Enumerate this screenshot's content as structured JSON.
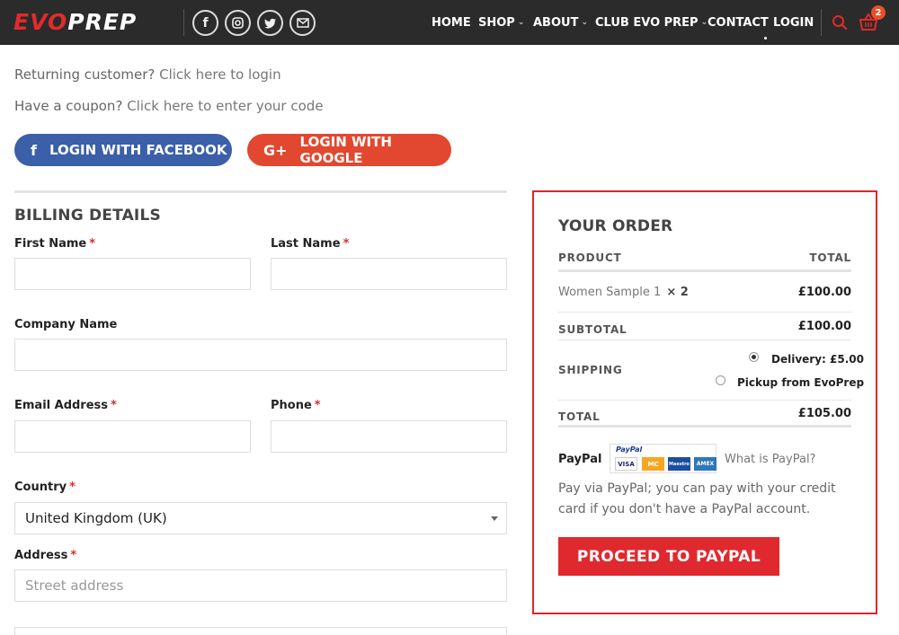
{
  "header": {
    "logo_evo": "EVO",
    "logo_prep": "PREP",
    "nav": [
      {
        "label": "HOME",
        "dropdown": false
      },
      {
        "label": "SHOP",
        "dropdown": true
      },
      {
        "label": "ABOUT",
        "dropdown": true
      },
      {
        "label": "CLUB EVO PREP",
        "dropdown": true
      },
      {
        "label": "CONTACT",
        "dropdown": false
      },
      {
        "label": "LOGIN",
        "dropdown": false
      }
    ],
    "social_icons": [
      "facebook-icon",
      "instagram-icon",
      "twitter-icon",
      "mail-icon"
    ],
    "cart_count": "2",
    "colors": {
      "bar": "#2b2b2b",
      "accent": "#e02b2b"
    }
  },
  "notices": {
    "returning_prefix": "Returning customer?",
    "returning_link": "Click here to login",
    "coupon_prefix": "Have a coupon?",
    "coupon_link": "Click here to enter your code"
  },
  "social_login": {
    "facebook_label": "LOGIN WITH FACEBOOK",
    "facebook_icon": "f",
    "google_label": "LOGIN WITH GOOGLE",
    "google_icon": "G+"
  },
  "billing": {
    "title": "BILLING DETAILS",
    "first_name_label": "First Name",
    "last_name_label": "Last Name",
    "company_label": "Company Name",
    "email_label": "Email Address",
    "phone_label": "Phone",
    "country_label": "Country",
    "country_value": "United Kingdom (UK)",
    "address_label": "Address",
    "street_placeholder": "Street address",
    "required_mark": "*"
  },
  "order": {
    "title": "YOUR ORDER",
    "col_product": "PRODUCT",
    "col_total": "TOTAL",
    "item_name": "Women Sample 1",
    "item_qty": "× 2",
    "item_total": "£100.00",
    "subtotal_label": "SUBTOTAL",
    "subtotal_value": "£100.00",
    "shipping_label": "SHIPPING",
    "shipping_options": [
      {
        "label": "Delivery: £5.00",
        "selected": true
      },
      {
        "label": "Pickup from EvoPrep",
        "selected": false
      }
    ],
    "total_label": "TOTAL",
    "total_value": "£105.00",
    "payment_label": "PayPal",
    "paypal_brand": "PayPal",
    "cards": [
      "VISA",
      "MC",
      "Maestro",
      "AMEX"
    ],
    "what_is_paypal": "What is PayPal?",
    "paypal_desc_1": "Pay via PayPal; you can pay with your credit",
    "paypal_desc_2": "card if you don't have a PayPal account.",
    "proceed_label": "PROCEED TO PAYPAL"
  }
}
